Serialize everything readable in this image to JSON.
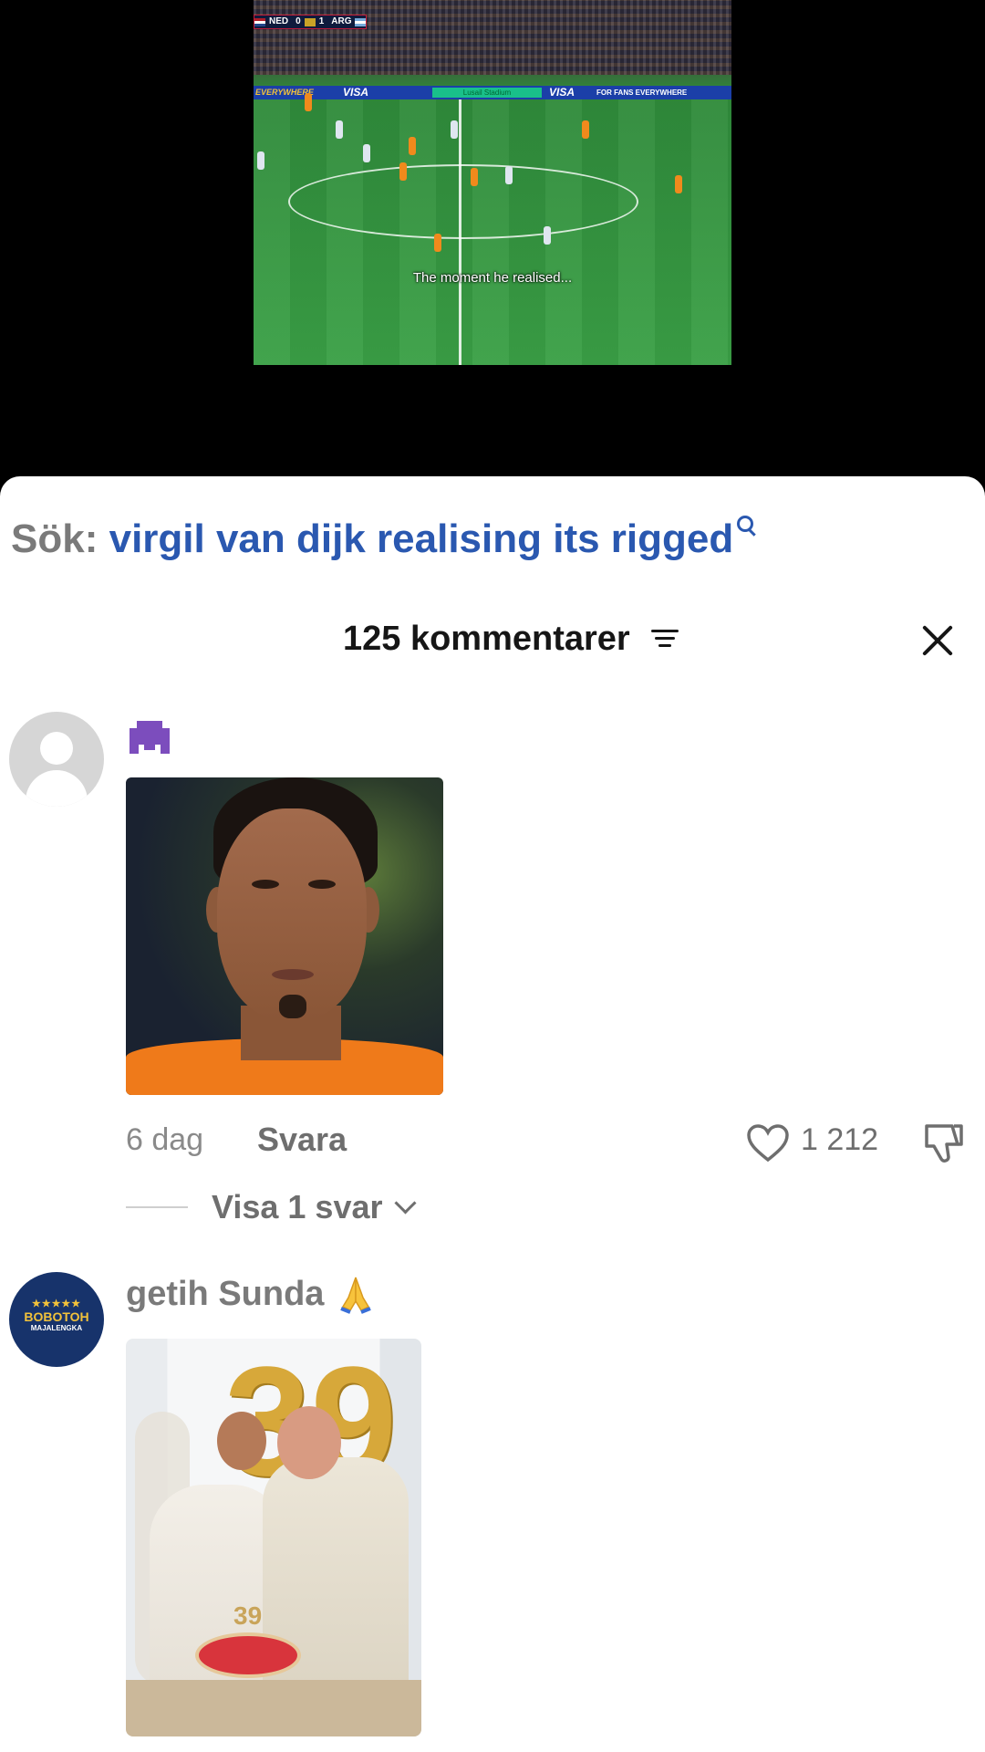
{
  "video": {
    "scorebug": {
      "home": "NED",
      "home_score": "0",
      "away_score": "1",
      "away": "ARG"
    },
    "ads": {
      "left": "VISA",
      "stadium": "Lusail Stadium",
      "right": "VISA",
      "tagline": "FOR FANS EVERYWHERE",
      "edge": "EVERYWHERE"
    },
    "caption": "The moment he realised..."
  },
  "search": {
    "prefix": "Sök:",
    "query": "virgil van dijk realising its rigged"
  },
  "header": {
    "comment_count": "125 kommentarer"
  },
  "comments": [
    {
      "username_emoji": "alien-monster",
      "time": "6 dag",
      "reply_label": "Svara",
      "likes": "1 212",
      "view_replies": "Visa 1 svar"
    },
    {
      "username": "getih Sunda",
      "username_emoji": "folded-hands",
      "avatar_text": {
        "stars": "★★★★★",
        "line1": "BOBOTOH",
        "line2": "MAJALENGKA"
      },
      "image_number": "39",
      "cake_number": "39"
    }
  ],
  "colors": {
    "accent": "#2a58b0",
    "muted": "#7a7a7a",
    "shirt": "#ef7a1a",
    "pitch": "#3aa046"
  }
}
